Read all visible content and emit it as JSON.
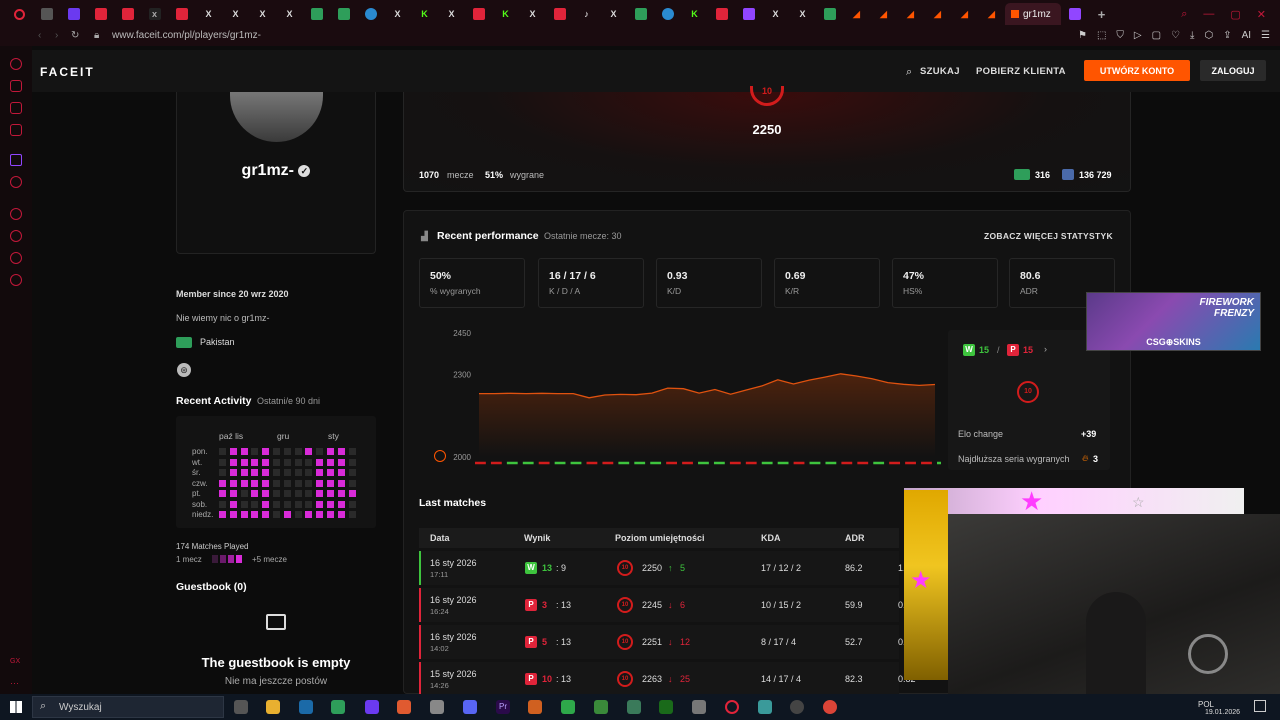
{
  "browser": {
    "active_tab_title": "gr1mz",
    "url": "www.faceit.com/pl/players/gr1mz-"
  },
  "header": {
    "logo": "FACEIT",
    "search": "SZUKAJ",
    "download_client": "POBIERZ KLIENTA",
    "create_account": "UTWÓRZ KONTO",
    "login": "ZALOGUJ"
  },
  "profile": {
    "nickname": "gr1mz-",
    "member_since": "Member since 20 wrz 2020",
    "about": "Nie wiemy nic o gr1mz-",
    "country": "Pakistan",
    "recent_activity_title": "Recent Activity",
    "recent_activity_range": "Ostatni/e 90 dni",
    "heatmap_months": [
      "paź lis",
      "gru",
      "sty"
    ],
    "heatmap_days": [
      "pon.",
      "wt.",
      "śr.",
      "czw.",
      "pt.",
      "sob.",
      "niedz."
    ],
    "matches_played": "174 Matches Played",
    "legend_min": "1 mecz",
    "legend_max": "+5 mecze",
    "guestbook_title": "Guestbook (0)",
    "guestbook_empty": "The guestbook is empty",
    "guestbook_sub": "Nie ma jeszcze postów"
  },
  "elo_panel": {
    "level": "10",
    "elo": "2250",
    "matches_count": "1070",
    "matches_label": "mecze",
    "win_pct": "51%",
    "win_label": "wygrane",
    "rank_country": "316",
    "rank_region": "136 729"
  },
  "performance": {
    "title": "Recent performance",
    "subtitle": "Ostatnie mecze: 30",
    "more_stats": "ZOBACZ WIĘCEJ STATYSTYK",
    "stats": [
      {
        "value": "50%",
        "label": "% wygranych"
      },
      {
        "value": "16 / 17 / 6",
        "label": "K / D / A"
      },
      {
        "value": "0.93",
        "label": "K/D"
      },
      {
        "value": "0.69",
        "label": "K/R"
      },
      {
        "value": "47%",
        "label": "HS%"
      },
      {
        "value": "80.6",
        "label": "ADR"
      }
    ],
    "wins": "15",
    "losses": "15",
    "level_badge": "10",
    "elo_change_label": "Elo change",
    "elo_change_value": "+39",
    "streak_label": "Najdłuższa seria wygranych",
    "streak_value": "3"
  },
  "chart_data": {
    "type": "line",
    "y_ticks": [
      "2450",
      "2300",
      "2000"
    ],
    "ylim": [
      2000,
      2450
    ],
    "values": [
      2230,
      2230,
      2231,
      2230,
      2231,
      2230,
      2230,
      2215,
      2225,
      2227,
      2226,
      2232,
      2250,
      2248,
      2232,
      2245,
      2228,
      2243,
      2258,
      2280,
      2265,
      2279,
      2290,
      2302,
      2294,
      2284,
      2270,
      2264,
      2260,
      2263
    ],
    "results": [
      "L",
      "L",
      "G",
      "G",
      "L",
      "G",
      "G",
      "L",
      "L",
      "G",
      "G",
      "G",
      "L",
      "L",
      "G",
      "G",
      "L",
      "L",
      "G",
      "G",
      "L",
      "G",
      "G",
      "L",
      "L",
      "G",
      "L",
      "L",
      "L",
      "G"
    ]
  },
  "last_matches": {
    "title": "Last matches",
    "columns": [
      "Data",
      "Wynik",
      "Poziom umiejętności",
      "KDA",
      "ADR"
    ],
    "rows": [
      {
        "date": "16 sty 2026",
        "time": "17:11",
        "result": "W",
        "score_a": "13",
        "score_b": "9",
        "elo": "2250",
        "delta": "5",
        "kda": "17 / 12 / 2",
        "adr": "86.2",
        "extra": "1.",
        "color": "#3ec43e"
      },
      {
        "date": "16 sty 2026",
        "time": "16:24",
        "result": "P",
        "score_a": "3",
        "score_b": "13",
        "elo": "2245",
        "delta": "6",
        "kda": "10 / 15 / 2",
        "adr": "59.9",
        "extra": "0.",
        "color": "#e0243a"
      },
      {
        "date": "16 sty 2026",
        "time": "14:02",
        "result": "P",
        "score_a": "5",
        "score_b": "13",
        "elo": "2251",
        "delta": "12",
        "kda": "8 / 17 / 4",
        "adr": "52.7",
        "extra": "0.",
        "color": "#e0243a"
      },
      {
        "date": "15 sty 2026",
        "time": "14:26",
        "result": "P",
        "score_a": "10",
        "score_b": "13",
        "elo": "2263",
        "delta": "25",
        "kda": "14 / 17 / 4",
        "adr": "82.3",
        "extra": "0.82",
        "color": "#e0243a"
      }
    ]
  },
  "ad": {
    "title": "FIREWORK FRENZY",
    "brand": "CSG⊕SKINS"
  },
  "taskbar": {
    "search": "Wyszukaj",
    "lang": "POL",
    "date": "19.01.2026"
  }
}
